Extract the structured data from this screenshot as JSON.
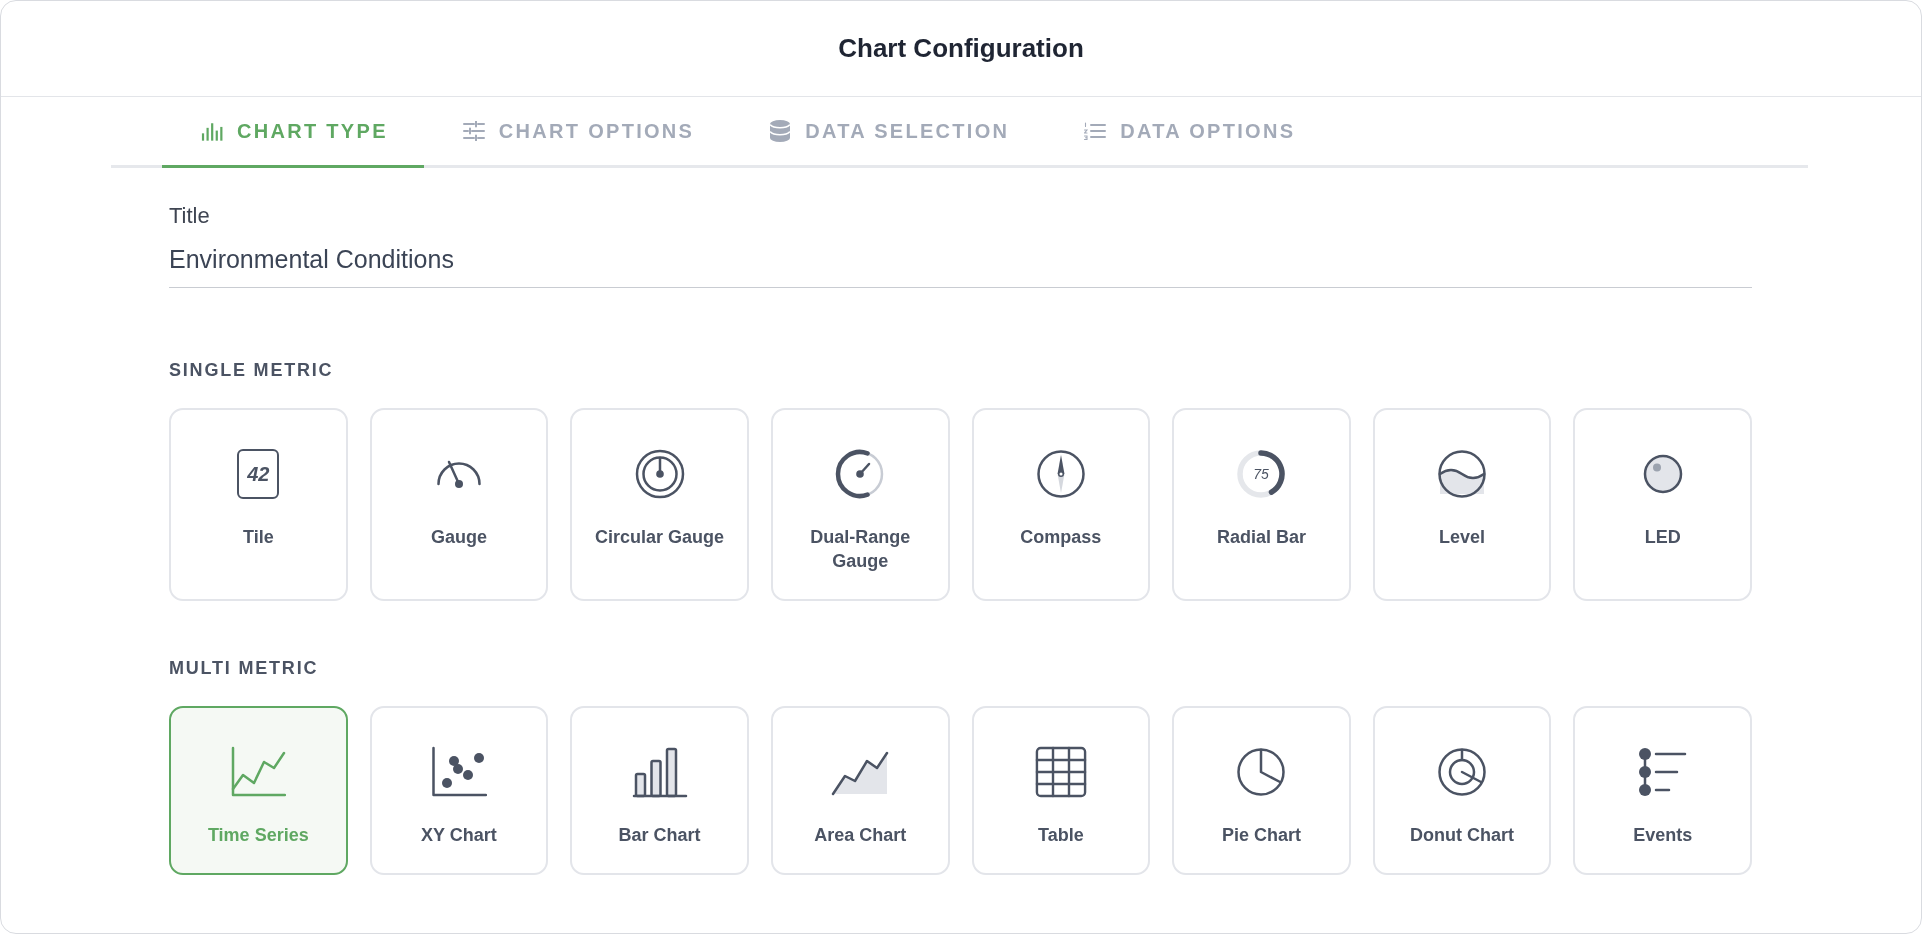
{
  "window": {
    "title": "Chart Configuration"
  },
  "tabs": [
    {
      "label": "CHART TYPE",
      "selected": true
    },
    {
      "label": "CHART OPTIONS",
      "selected": false
    },
    {
      "label": "DATA SELECTION",
      "selected": false
    },
    {
      "label": "DATA OPTIONS",
      "selected": false
    }
  ],
  "title_field": {
    "label": "Title",
    "value": "Environmental Conditions"
  },
  "sections": [
    {
      "heading": "SINGLE METRIC",
      "types": [
        {
          "label": "Tile",
          "kind": "tile",
          "icon_text": "42",
          "selected": false
        },
        {
          "label": "Gauge",
          "kind": "gauge",
          "selected": false
        },
        {
          "label": "Circular Gauge",
          "kind": "circular",
          "selected": false
        },
        {
          "label": "Dual-Range Gauge",
          "kind": "dualrange",
          "selected": false
        },
        {
          "label": "Compass",
          "kind": "compass",
          "selected": false
        },
        {
          "label": "Radial Bar",
          "kind": "radial",
          "icon_text": "75",
          "selected": false
        },
        {
          "label": "Level",
          "kind": "level",
          "selected": false
        },
        {
          "label": "LED",
          "kind": "led",
          "selected": false
        }
      ]
    },
    {
      "heading": "MULTI METRIC",
      "types": [
        {
          "label": "Time Series",
          "kind": "timeseries",
          "selected": true
        },
        {
          "label": "XY Chart",
          "kind": "scatter",
          "selected": false
        },
        {
          "label": "Bar Chart",
          "kind": "bar",
          "selected": false
        },
        {
          "label": "Area Chart",
          "kind": "area",
          "selected": false
        },
        {
          "label": "Table",
          "kind": "table",
          "selected": false
        },
        {
          "label": "Pie Chart",
          "kind": "pie",
          "selected": false
        },
        {
          "label": "Donut Chart",
          "kind": "donut",
          "selected": false
        },
        {
          "label": "Events",
          "kind": "events",
          "selected": false
        }
      ]
    }
  ]
}
